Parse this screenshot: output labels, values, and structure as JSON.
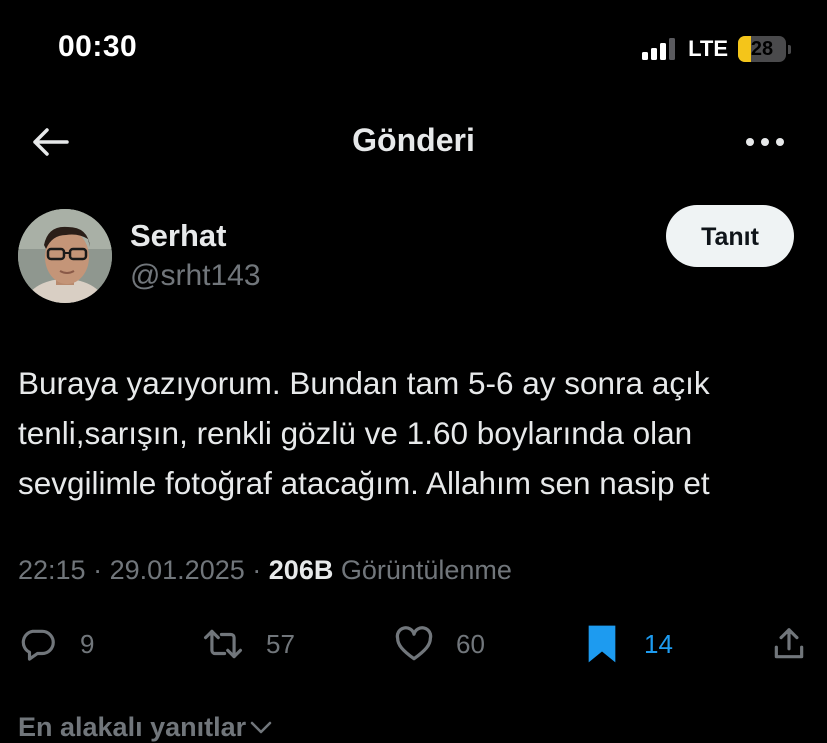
{
  "status_bar": {
    "time": "00:30",
    "network": "LTE",
    "battery": "28",
    "battery_level": 0.28,
    "battery_color": "#f4c51a"
  },
  "nav": {
    "title": "Gönderi",
    "back_icon": "arrow-left-icon",
    "more_icon": "more-horizontal-icon"
  },
  "author": {
    "name": "Serhat",
    "handle": "@srht143",
    "follow_label": "Tanıt"
  },
  "tweet": {
    "text": "Buraya yazıyorum. Bundan tam 5-6 ay sonra açık\ntenli,sarışın, renkli gözlü ve 1.60 boylarında olan\nsevgilimle fotoğraf atacağım. Allahım sen nasip et",
    "time": "22:15",
    "separator": "·",
    "date": "29.01.2025",
    "views_count": "206B",
    "views_label": "Görüntülenme"
  },
  "actions": {
    "replies": "9",
    "retweets": "57",
    "likes": "60",
    "bookmarks": "14",
    "bookmark_color": "#1d9bf0"
  },
  "replies_sort": {
    "label": "En alakalı yanıtlar"
  }
}
